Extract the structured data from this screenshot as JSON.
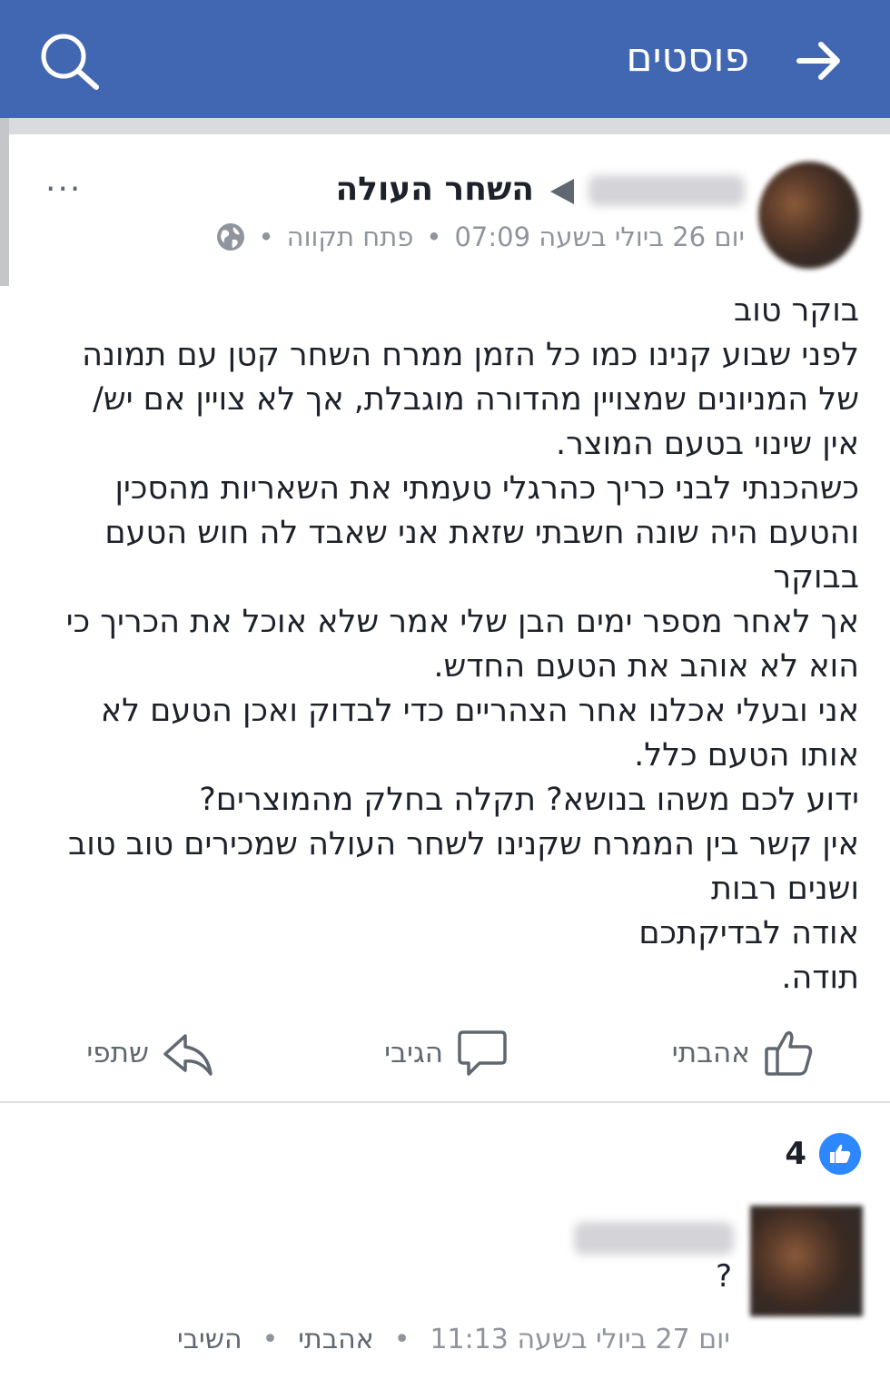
{
  "header": {
    "title": "פוסטים",
    "back_icon": "arrow-right-icon",
    "search_icon": "search-icon",
    "bg_color": "#4267b2"
  },
  "post": {
    "group_name": "השחר העולה",
    "timestamp": "יום 26 ביולי בשעה 07:09",
    "location": "פתח תקווה",
    "separator": "•",
    "privacy_icon": "globe-icon",
    "more_label": "···",
    "body_lines": [
      "בוקר טוב",
      "לפני שבוע קנינו כמו כל הזמן ממרח השחר קטן עם תמונה",
      "של המניונים שמצויין מהדורה מוגבלת, אך לא צויין אם יש/",
      "אין שינוי בטעם המוצר.",
      "כשהכנתי לבני כריך כהרגלי טעמתי את השאריות מהסכין",
      "והטעם היה שונה חשבתי שזאת אני שאבד לה חוש הטעם",
      "בבוקר",
      "אך לאחר מספר ימים הבן שלי אמר שלא אוכל את הכריך כי",
      "הוא לא אוהב את הטעם החדש.",
      "אני ובעלי אכלנו אחר הצהריים כדי לבדוק ואכן הטעם לא",
      "אותו הטעם כלל.",
      "ידוע לכם משהו בנושא? תקלה בחלק מהמוצרים?",
      "אין קשר בין הממרח שקנינו לשחר העולה שמכירים טוב טוב",
      "ושנים רבות",
      "אודה לבדיקתכם",
      "תודה."
    ]
  },
  "actions": {
    "like_label": "אהבתי",
    "comment_label": "הגיבי",
    "share_label": "שתפי"
  },
  "reactions": {
    "count": "4",
    "icon": "like-badge-icon"
  },
  "comment": {
    "text": "?",
    "timestamp": "יום 27 ביולי בשעה 11:13",
    "separator": "•",
    "like_label": "אהבתי",
    "reply_label": "השיבי"
  }
}
